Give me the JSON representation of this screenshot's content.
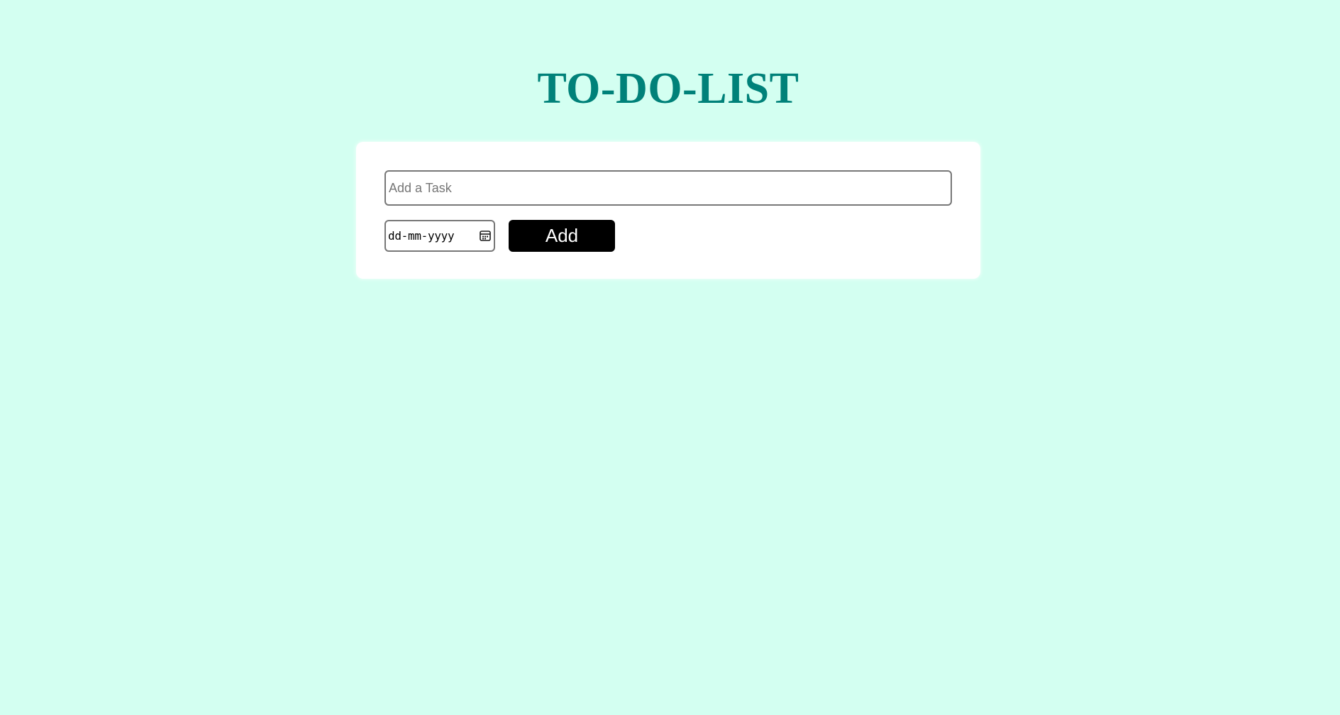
{
  "header": {
    "title": "TO-DO-LIST"
  },
  "form": {
    "task_placeholder": "Add a Task",
    "task_value": "",
    "date_placeholder": "dd-mm-yyyy",
    "add_label": "Add"
  },
  "icons": {
    "calendar": "calendar-icon"
  },
  "colors": {
    "background": "#d3fff1",
    "title": "#008179",
    "card": "#ffffff",
    "button": "#000000",
    "button_text": "#ffffff"
  }
}
